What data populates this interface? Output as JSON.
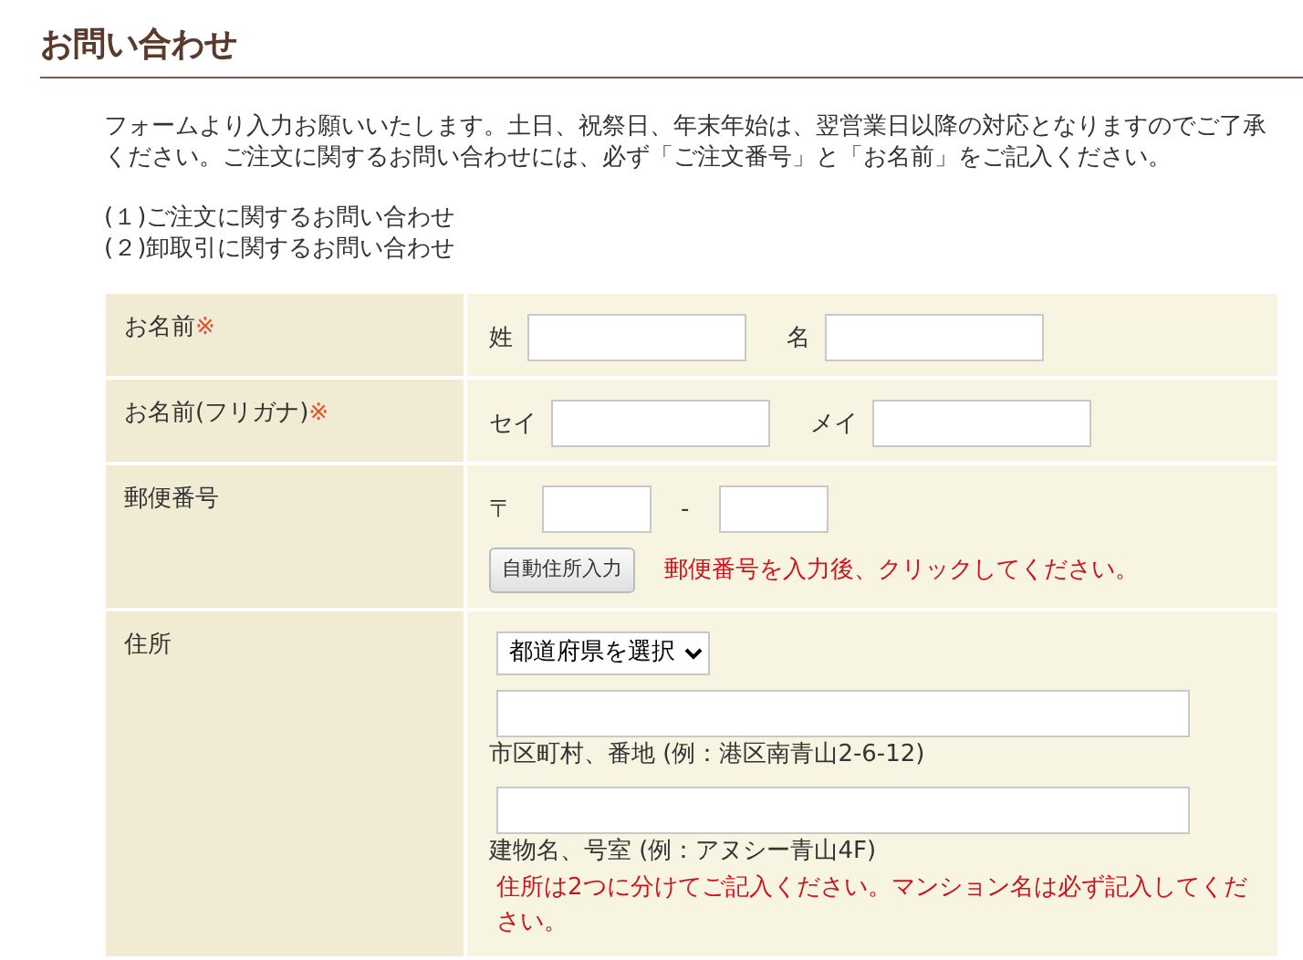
{
  "title": "お問い合わせ",
  "intro": "フォームより入力お願いいたします。土日、祝祭日、年末年始は、翌営業日以降の対応となりますのでご了承ください。ご注文に関するお問い合わせには、必ず「ご注文番号」と「お名前」をご記入ください。",
  "links": [
    "(１)ご注文に関するお問い合わせ",
    "(２)卸取引に関するお問い合わせ"
  ],
  "form": {
    "rows": [
      {
        "kind": "name",
        "label": "お名前",
        "required_mark": "※",
        "fields": [
          {
            "label": "姓"
          },
          {
            "label": "名"
          }
        ]
      },
      {
        "kind": "name",
        "label": "お名前(フリガナ)",
        "required_mark": "※",
        "fields": [
          {
            "label": "セイ"
          },
          {
            "label": "メイ"
          }
        ]
      },
      {
        "kind": "zip",
        "label": "郵便番号",
        "prefix": "〒",
        "separator": "-",
        "button": "自動住所入力",
        "note": "郵便番号を入力後、クリックしてください。"
      },
      {
        "kind": "address",
        "label": "住所",
        "select": "都道府県を選択",
        "hints": [
          "市区町村、番地 (例：港区南青山2-6-12)",
          "建物名、号室 (例：アヌシー青山4F)"
        ],
        "note": "住所は2つに分けてご記入ください。マンション名は必ず記入してください。"
      }
    ]
  }
}
